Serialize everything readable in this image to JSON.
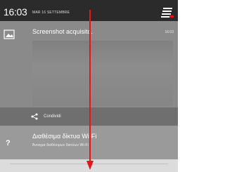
{
  "status_bar": {
    "time": "16:03",
    "date": "MAR 16 SETTEMBRE",
    "settings_icon": "settings-list-icon"
  },
  "notifications": {
    "screenshot": {
      "icon": "image-icon",
      "title": "Screenshot acquisito.",
      "time": "16:03",
      "action": {
        "icon": "share-icon",
        "label": "Condividi"
      }
    },
    "wifi": {
      "icon": "wifi-question-icon",
      "title": "Διαθέσιμα δίκτυα Wi-Fi",
      "subtitle": "Άνοιγμα διαθέσιμων δικτύων Wi-Fi"
    }
  },
  "overlay": {
    "arrow_icon": "swipe-down-arrow-icon",
    "arrow_color": "#e4161c"
  },
  "colors": {
    "status_bar": "#2b2b2b",
    "panel": "#8a8a8a",
    "accent": "#e4161c"
  }
}
